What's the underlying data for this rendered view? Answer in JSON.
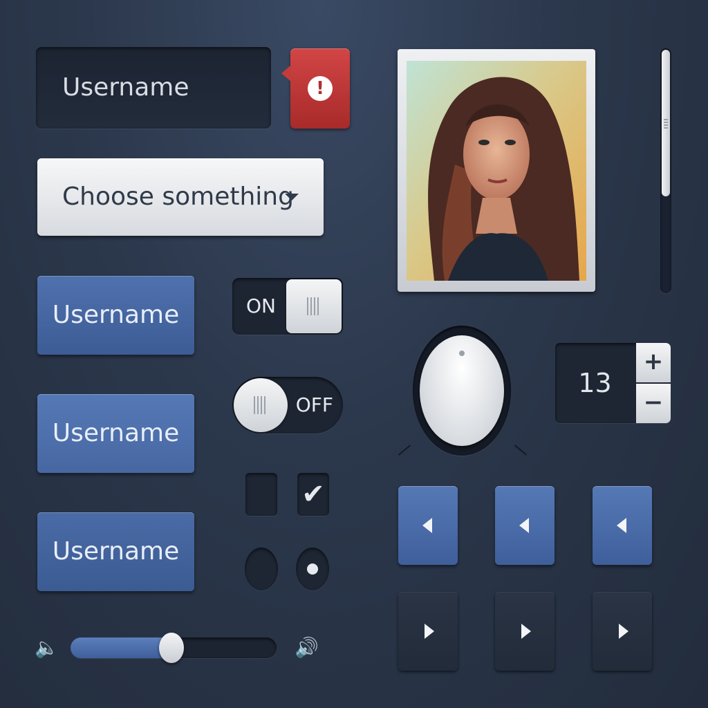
{
  "login": {
    "username_value": "Username",
    "alert_symbol": "!",
    "alert_icon": "exclamation-icon",
    "alert_color": "#c33b3b"
  },
  "dropdown": {
    "selected": "Choose something",
    "icon": "caret-down-icon"
  },
  "buttons": [
    {
      "label": "Username"
    },
    {
      "label": "Username"
    },
    {
      "label": "Username"
    }
  ],
  "toggles": [
    {
      "label": "ON",
      "state": "on"
    },
    {
      "label": "OFF",
      "state": "off"
    }
  ],
  "checkboxes": [
    {
      "checked": false
    },
    {
      "checked": true,
      "mark": "✔"
    }
  ],
  "radios": [
    {
      "selected": false
    },
    {
      "selected": true
    }
  ],
  "volume": {
    "value": 0.49,
    "low_icon": "volume-low-icon",
    "high_icon": "volume-high-icon",
    "low_glyph": "🔈",
    "high_glyph": "🔊"
  },
  "stepper": {
    "value": "13",
    "plus": "+",
    "minus": "−"
  },
  "scrollbar": {
    "position": 0.0,
    "thumb_fraction": 0.6
  },
  "arrows": {
    "left_count": 3,
    "right_count": 3
  },
  "colors": {
    "accent_blue": "#4f71ad",
    "background": "#2b374b",
    "alert_red": "#c33b3b"
  }
}
